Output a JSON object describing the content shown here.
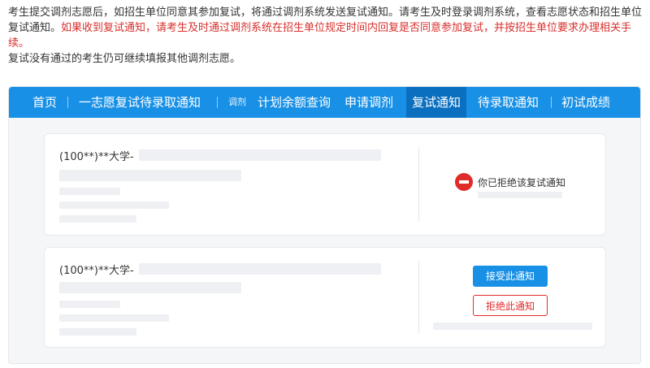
{
  "notice": {
    "line1": "考生提交调剂志愿后，如招生单位同意其参加复试，将通过调剂系统发送复试通知。请考生及时登录调剂系统，查看志愿状态和招生单位复试通知。",
    "line1_red": "如果收到复试通知，请考生及时通过调剂系统在招生单位规定时间内回复是否同意参加复试，并按招生单位要求办理相关手续。",
    "line2": "复试没有通过的考生仍可继续填报其他调剂志愿。"
  },
  "nav": {
    "items": [
      "首页",
      "一志愿复试待录取通知",
      "调剂",
      "计划余额查询",
      "申请调剂",
      "复试通知",
      "待录取通知",
      "初试成绩"
    ],
    "active_index": 5
  },
  "cards": [
    {
      "school": "(100**)**大学-",
      "status_text": "你已拒绝该复试通知"
    },
    {
      "school": "(100**)**大学-",
      "accept_label": "接受此通知",
      "reject_label": "拒绝此通知"
    }
  ],
  "colors": {
    "nav_bg": "#1890e6",
    "nav_active": "#0b6fc0",
    "red": "#d7302c",
    "primary": "#1890e6"
  },
  "icons": {
    "reject_status": "minus-circle-icon"
  }
}
